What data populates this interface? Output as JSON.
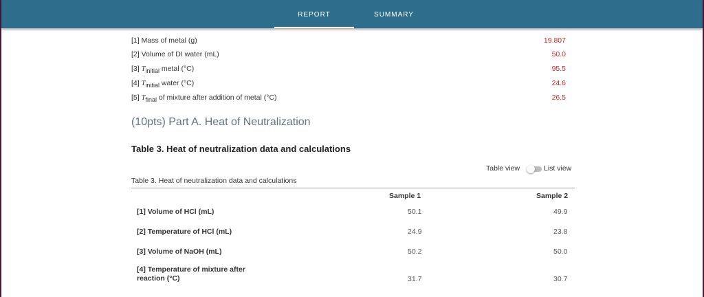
{
  "tabs": [
    {
      "label": "REPORT",
      "active": true
    },
    {
      "label": "SUMMARY",
      "active": false
    }
  ],
  "measurements": [
    {
      "prefix": "[1] Mass of metal (g)",
      "value": "19.807"
    },
    {
      "prefix": "[2] Volume of DI water (mL)",
      "value": "50.0"
    },
    {
      "prefix": "[3] ",
      "symbol": "T",
      "sub": "initial",
      "suffix": " metal (°C)",
      "value": "95.5"
    },
    {
      "prefix": "[4] ",
      "symbol": "T",
      "sub": "initial",
      "suffix": " water (°C)",
      "value": "24.6"
    },
    {
      "prefix": "[5] ",
      "symbol": "T",
      "sub": "final",
      "suffix": " of mixture after addition of metal (°C)",
      "value": "26.5"
    }
  ],
  "section_title": "(10pts) Part A. Heat of Neutralization",
  "table_heading": "Table 3. Heat of neutralization data and calculations",
  "view_toggle": {
    "table_label": "Table view",
    "list_label": "List view",
    "selected": "Table view"
  },
  "table": {
    "caption": "Table 3. Heat of neutralization data and calculations",
    "columns": [
      "Sample 1",
      "Sample 2"
    ],
    "rows": [
      {
        "label": "[1] Volume of HCl (mL)",
        "values": [
          "50.1",
          "49.9"
        ]
      },
      {
        "label": "[2] Temperature of HCl (mL)",
        "values": [
          "24.9",
          "23.8"
        ]
      },
      {
        "label": "[3] Volume of NaOH (mL)",
        "values": [
          "50.2",
          "50.0"
        ]
      },
      {
        "label_line1": "[4] Temperature of mixture after",
        "label_line2": "reaction (°C)",
        "values": [
          "31.7",
          "30.7"
        ]
      }
    ]
  },
  "colors": {
    "header": "#2e6e8c",
    "value_red": "#c62828",
    "section_title": "#5f7380"
  }
}
